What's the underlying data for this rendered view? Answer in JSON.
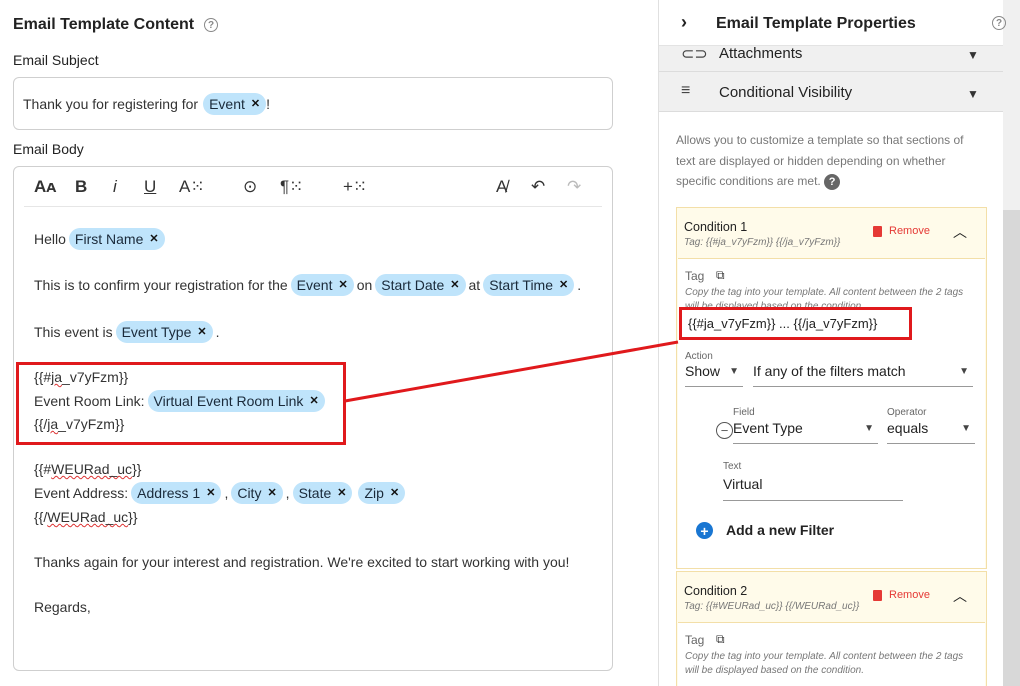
{
  "content": {
    "title": "Email Template Content",
    "subject_label": "Email Subject",
    "subject_text": "Thank you for registering for",
    "subject_chip": "Event",
    "subject_end": "!",
    "body_label": "Email Body",
    "toolbar": [
      "Aᴀ",
      "B",
      "i",
      "U",
      "A⁙",
      "⊙",
      "¶⁙",
      "+⁙",
      "A̸",
      "↶",
      "↷"
    ],
    "body": {
      "hello": "Hello",
      "first_name": "First Name",
      "confirm": "This is to confirm your registration for the",
      "event": "Event",
      "on": "on",
      "start_date": "Start Date",
      "at": "at",
      "start_time": "Start Time",
      "period": ".",
      "event_is": "This event is",
      "event_type": "Event Type",
      "open_tag_pre": "{{#",
      "open_tag_word": "ja",
      "open_tag_rest": "_v7yFzm}}",
      "room_link_label": "Event Room Link:",
      "room_link": "Virtual Event Room Link",
      "close_tag_pre": "{{/",
      "close_tag_word": "ja",
      "close_tag_rest": "_v7yFzm}}",
      "open2_pre": "{{#",
      "open2_word": "WEURad_uc",
      "open2_rest": "}}",
      "address_label": "Event Address:",
      "address1": "Address 1",
      "city": "City",
      "state": "State",
      "zip": "Zip",
      "comma": ",",
      "close2_pre": "{{/",
      "close2_word": "WEURad_uc",
      "close2_rest": "}}",
      "thanks": "Thanks again for your interest and registration. We're excited to start working with you!",
      "regards": "Regards,"
    }
  },
  "properties": {
    "title": "Email Template Properties",
    "attachments": "Attachments",
    "conditional": "Conditional Visibility",
    "description": "Allows you to customize a template so that sections of text are displayed or hidden depending on whether specific conditions are met.",
    "conditions": [
      {
        "title": "Condition 1",
        "tag_line": "Tag: {{#ja_v7yFzm}} {{/ja_v7yFzm}}",
        "remove": "Remove",
        "tag_label": "Tag",
        "hint": "Copy the tag into your template. All content between the 2 tags will be displayed based on the condition.",
        "tag_value": "{{#ja_v7yFzm}}  ...  {{/ja_v7yFzm}}",
        "action_label": "Action",
        "action": "Show",
        "match": "If any of the filters match",
        "field_label": "Field",
        "field": "Event Type",
        "operator_label": "Operator",
        "operator": "equals",
        "text_label": "Text",
        "text": "Virtual",
        "add_filter": "Add a new Filter"
      },
      {
        "title": "Condition 2",
        "tag_line": "Tag: {{#WEURad_uc}} {{/WEURad_uc}}",
        "remove": "Remove",
        "tag_label": "Tag",
        "hint": "Copy the tag into your template. All content between the 2 tags will be displayed based on the condition."
      }
    ]
  },
  "colors": {
    "chip": "#bfe4fb",
    "highlight": "#e0191c",
    "remove": "#e53935",
    "accent": "#1976d2"
  }
}
